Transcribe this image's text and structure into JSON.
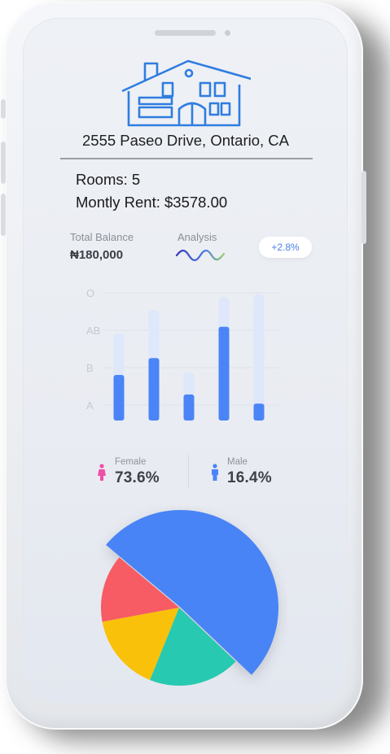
{
  "property": {
    "address": "2555 Paseo Drive, Ontario, CA",
    "rooms": "Rooms: 5",
    "rent": "Montly Rent: $3578.00"
  },
  "balance": {
    "label": "Total Balance",
    "value": "₦180,000",
    "analysis_label": "Analysis",
    "change": "+2.8%"
  },
  "colors": {
    "accent": "#4a84f6",
    "accent_light": "#dfe7fb",
    "house": "#2f7de1",
    "teal": "#27c9b0",
    "yellow": "#f9c10a",
    "red": "#f75b63",
    "female": "#ef4fa6"
  },
  "chart_data": [
    {
      "type": "bar",
      "y_tick_labels": [
        "O",
        "AB",
        "B",
        "A"
      ],
      "grid": true,
      "series": [
        {
          "values": [
            0.67,
            0.85,
            0.37,
            0.95,
            0.97
          ]
        },
        {
          "values": [
            0.35,
            0.48,
            0.2,
            0.72,
            0.13
          ]
        }
      ]
    },
    {
      "type": "pie",
      "slices": [
        {
          "value": 51,
          "color": "#4a84f6"
        },
        {
          "value": 19,
          "color": "#27c9b0"
        },
        {
          "value": 16,
          "color": "#f9c10a"
        },
        {
          "value": 14,
          "color": "#f75b63"
        }
      ]
    }
  ],
  "gender": {
    "female_label": "Female",
    "female_value": "73.6%",
    "male_label": "Male",
    "male_value": "16.4%",
    "female_icon": "female-icon",
    "male_icon": "male-icon"
  }
}
